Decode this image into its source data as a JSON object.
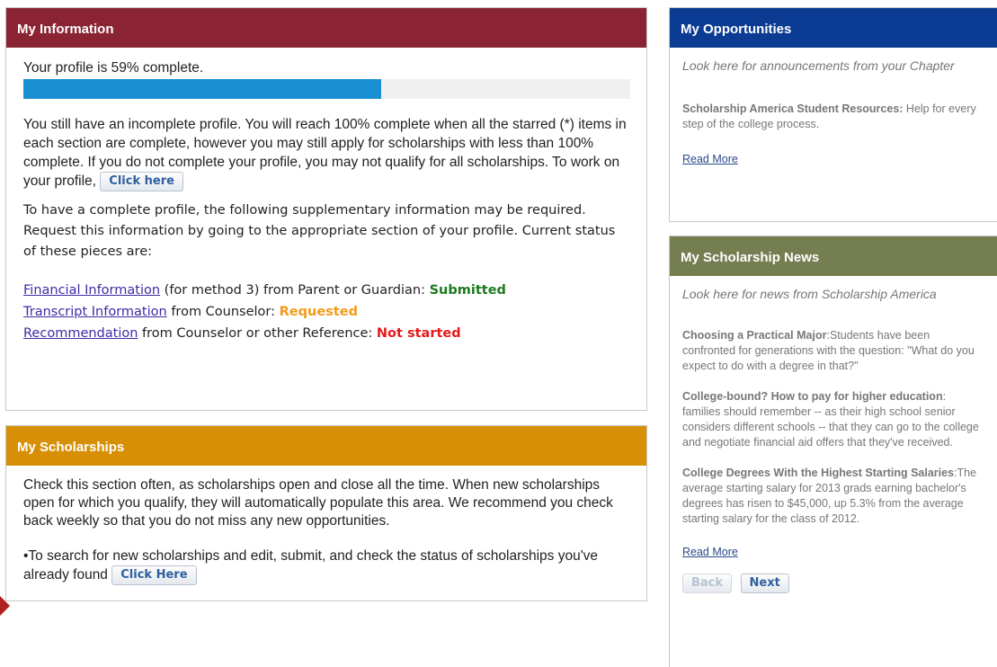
{
  "colors": {
    "info_header": "#8a2332",
    "scholarships_header": "#d78f05",
    "opportunities_header": "#0b3b93",
    "news_header": "#757e51",
    "progress_fill": "#1a90d2",
    "status_submitted": "#1e7a1e",
    "status_requested": "#f29b1a",
    "status_not_started": "#e21b1b"
  },
  "my_information": {
    "title": "My Information",
    "progress_text": "Your profile is 59% complete.",
    "progress_percent": 59,
    "incomplete_text": "You still have an incomplete profile. You will reach 100% complete when all the starred (*) items in each section are complete, however you may still apply for scholarships with less than 100% complete. If you do not complete your profile, you may not qualify for all scholarships. To work on your profile,",
    "click_here_label": "Click here",
    "supplementary_text": "To have a complete profile, the following supplementary information may be required. Request this information by going to the appropriate section of your profile. Current status of these pieces are:",
    "items": [
      {
        "link": "Financial Information",
        "text": " (for method 3) from Parent or Guardian: ",
        "status": "Submitted"
      },
      {
        "link": "Transcript Information",
        "text": " from Counselor: ",
        "status": "Requested"
      },
      {
        "link": "Recommendation",
        "text": " from Counselor or other Reference: ",
        "status": "Not started"
      }
    ]
  },
  "my_scholarships": {
    "title": "My Scholarships",
    "text": "Check this section often, as scholarships open and close all the time.  When new scholarships open for which you qualify, they will automatically populate this area.  We recommend you check back weekly so that you do not miss any new opportunities.",
    "search_text": "•To search for new scholarships and edit, submit, and check the status of scholarships you've already found",
    "click_here_label": "Click Here"
  },
  "my_opportunities": {
    "title": "My Opportunities",
    "intro": "Look here for announcements from your Chapter",
    "item_title": "Scholarship America Student Resources:",
    "item_text": " Help for every step of the college process.",
    "read_more": "Read More"
  },
  "my_scholarship_news": {
    "title": "My Scholarship News",
    "intro": "Look here for news from Scholarship America",
    "articles": [
      {
        "title": "Choosing a Practical Major",
        "text": ":Students have been confronted for generations with the question: \"What do you expect to do with a degree in that?\""
      },
      {
        "title": "College-bound? How to pay for higher education",
        "text": ": families should remember -- as their high school senior considers different schools -- that they can go to the college and negotiate financial aid offers that they've received."
      },
      {
        "title": "College Degrees With the Highest Starting Salaries",
        "text": ":The average starting salary for 2013 grads earning bachelor's degrees has risen to $45,000, up 5.3% from the average starting salary for the class of 2012."
      }
    ],
    "read_more": "Read More",
    "back_label": "Back",
    "next_label": "Next"
  }
}
